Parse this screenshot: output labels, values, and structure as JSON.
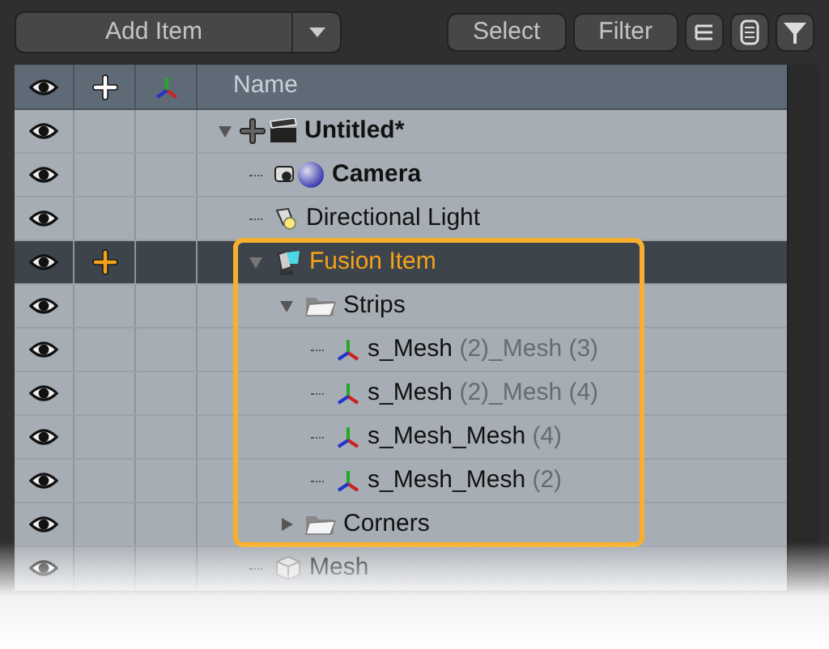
{
  "toolbar": {
    "add_item": "Add Item",
    "buttons": [
      "Select",
      "Filter"
    ]
  },
  "header": {
    "name_column": "Name"
  },
  "tree": [
    {
      "name": "Untitled*",
      "kind": "scene",
      "bold": true,
      "visible": true,
      "marked": false,
      "selected": false,
      "highlighted": false,
      "expanded": true,
      "children": [
        {
          "name": "Camera",
          "kind": "camera",
          "bold": true,
          "visible": true,
          "marked": false,
          "selected": false,
          "highlighted": false
        },
        {
          "name": "Directional Light",
          "kind": "light",
          "bold": false,
          "visible": true,
          "marked": false,
          "selected": false,
          "highlighted": false
        },
        {
          "name": "Fusion Item",
          "kind": "fusion",
          "bold": false,
          "visible": true,
          "marked": true,
          "selected": true,
          "highlighted": true,
          "expanded": true,
          "children": [
            {
              "name": "Strips",
              "kind": "folder",
              "bold": false,
              "visible": true,
              "marked": false,
              "selected": false,
              "highlighted": false,
              "expanded": true,
              "children": [
                {
                  "name": "s_Mesh",
                  "suffix": " (2)_Mesh (3)",
                  "kind": "axes",
                  "bold": false,
                  "visible": true,
                  "marked": false,
                  "selected": false,
                  "highlighted": false
                },
                {
                  "name": "s_Mesh",
                  "suffix": " (2)_Mesh (4)",
                  "kind": "axes",
                  "bold": false,
                  "visible": true,
                  "marked": false,
                  "selected": false,
                  "highlighted": false
                },
                {
                  "name": "s_Mesh_Mesh",
                  "suffix": " (4)",
                  "kind": "axes",
                  "bold": false,
                  "visible": true,
                  "marked": false,
                  "selected": false,
                  "highlighted": false
                },
                {
                  "name": "s_Mesh_Mesh",
                  "suffix": " (2)",
                  "kind": "axes",
                  "bold": false,
                  "visible": true,
                  "marked": false,
                  "selected": false,
                  "highlighted": false
                }
              ]
            },
            {
              "name": "Corners",
              "kind": "folder",
              "bold": false,
              "visible": true,
              "marked": false,
              "selected": false,
              "highlighted": false,
              "expanded": false
            }
          ]
        },
        {
          "name": "Mesh",
          "kind": "cube",
          "bold": false,
          "visible": true,
          "marked": false,
          "selected": false,
          "highlighted": false
        }
      ]
    }
  ]
}
